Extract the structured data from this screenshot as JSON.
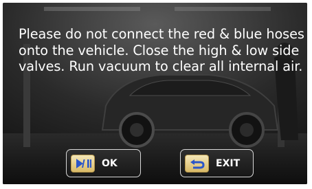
{
  "message": "Please do not connect the red & blue hoses onto the vehicle. Close the high & low side valves. Run vacuum to clear all internal air.",
  "buttons": {
    "ok_label": "OK",
    "exit_label": "EXIT"
  },
  "icons": {
    "ok": "play-pause-icon",
    "exit": "return-arrow-icon"
  },
  "colors": {
    "text": "#ffffff",
    "key_gold": "#e6cf86",
    "icon_blue": "#2b56c9"
  }
}
